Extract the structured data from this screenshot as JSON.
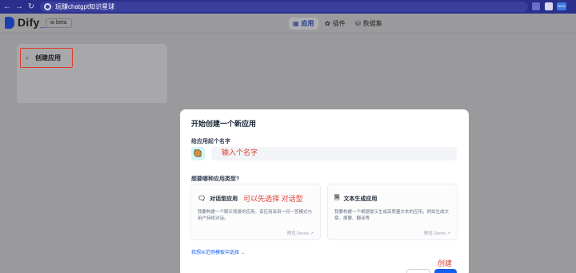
{
  "browser": {
    "tab_title": "玩赚chatgpt知识星球",
    "ext_badge": "NEW"
  },
  "header": {
    "logo": "Dify",
    "logo_suffix": "_",
    "beta": "beta",
    "tabs": [
      {
        "label": "应用",
        "icon": "grid-icon"
      },
      {
        "label": "插件",
        "icon": "puzzle-icon"
      },
      {
        "label": "数据集",
        "icon": "database-icon"
      }
    ]
  },
  "apps": {
    "create_label": "创建应用",
    "plus": "+"
  },
  "modal": {
    "title": "开始创建一个新应用",
    "name_label": "给应用起个名字",
    "name_input_annotation": "输入个名字",
    "icon_emoji": "🥘",
    "type_label": "想要哪种应用类型?",
    "types": [
      {
        "label": "对话型应用",
        "annotation": "可以先选择 对话型",
        "desc": "我要构建一个聊天场景的应用。该应用采用一问一答模式与用户持续对话。",
        "demo": "预览 Demo ↗",
        "icon": "chat-icon"
      },
      {
        "label": "文本生成应用",
        "annotation": "",
        "desc": "我要构建一个根据提示生成高质量文本的应用，例如生成文章、摘要、翻译等",
        "demo": "预览 Demo ↗",
        "icon": "document-icon"
      }
    ],
    "template_link": "我想从范例模板中选择 →",
    "create_annotation": "创建"
  },
  "colors": {
    "accent": "#155eef",
    "annotation_red": "#e23b2a",
    "browser_bar": "#2b2f8c"
  }
}
